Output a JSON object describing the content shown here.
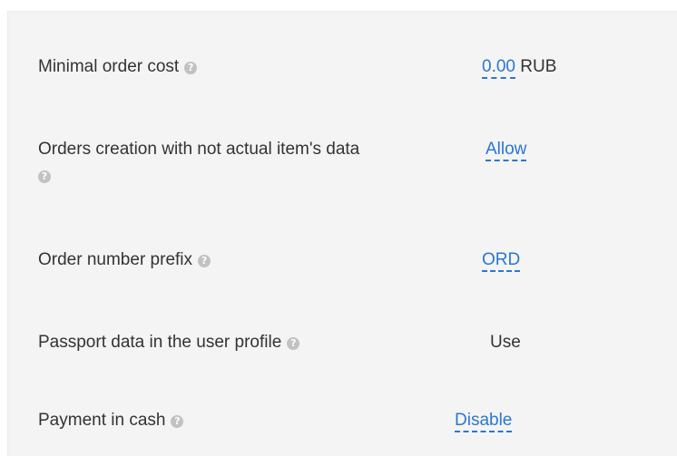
{
  "settings": {
    "min_order_cost": {
      "label": "Minimal order cost",
      "value": "0.00",
      "unit": "RUB"
    },
    "orders_not_actual": {
      "label": "Orders creation with not actual item's data",
      "value": "Allow"
    },
    "order_prefix": {
      "label": "Order number prefix",
      "value": "ORD"
    },
    "passport_data": {
      "label": "Passport data in the user profile",
      "value": "Use"
    },
    "payment_cash": {
      "label": "Payment in cash",
      "value": "Disable"
    }
  },
  "icons": {
    "help": "help-icon",
    "help_glyph": "?"
  }
}
